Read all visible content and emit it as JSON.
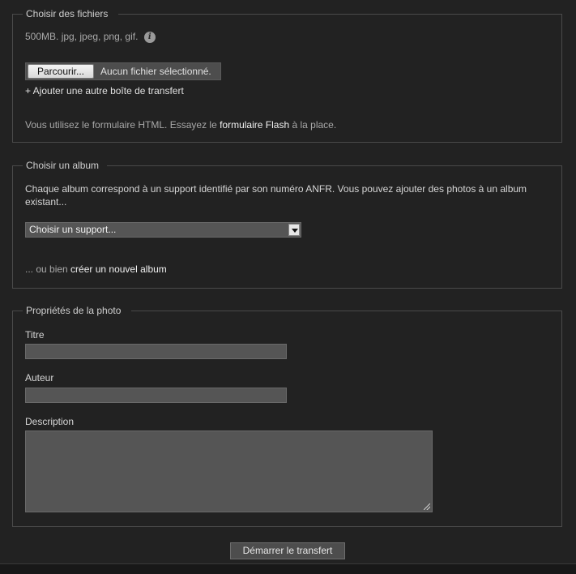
{
  "files": {
    "legend": "Choisir des fichiers",
    "formats": "500MB. jpg, jpeg, png, gif.",
    "browse_label": "Parcourir...",
    "no_file": "Aucun fichier sélectionné.",
    "add_box": "+ Ajouter une autre boîte de transfert",
    "html_note_before": "Vous utilisez le formulaire HTML. Essayez le ",
    "flash_link": "formulaire Flash",
    "html_note_after": " à la place."
  },
  "album": {
    "legend": "Choisir un album",
    "description": "Chaque album correspond à un support identifié par son numéro ANFR. Vous pouvez ajouter des photos à un album existant...",
    "select_value": "Choisir un support...",
    "or_text": "... ou bien ",
    "create_link": "créer un nouvel album"
  },
  "photo": {
    "legend": "Propriétés de la photo",
    "title_label": "Titre",
    "title_value": "",
    "author_label": "Auteur",
    "author_value": "",
    "description_label": "Description",
    "description_value": ""
  },
  "submit_label": "Démarrer le transfert",
  "icons": {
    "info": "info-icon",
    "select_arrow": "chevron-down-icon",
    "resize_grip": "resize-grip-icon"
  },
  "colors": {
    "background": "#222222",
    "border": "#4a4a4a",
    "field": "#555555"
  }
}
